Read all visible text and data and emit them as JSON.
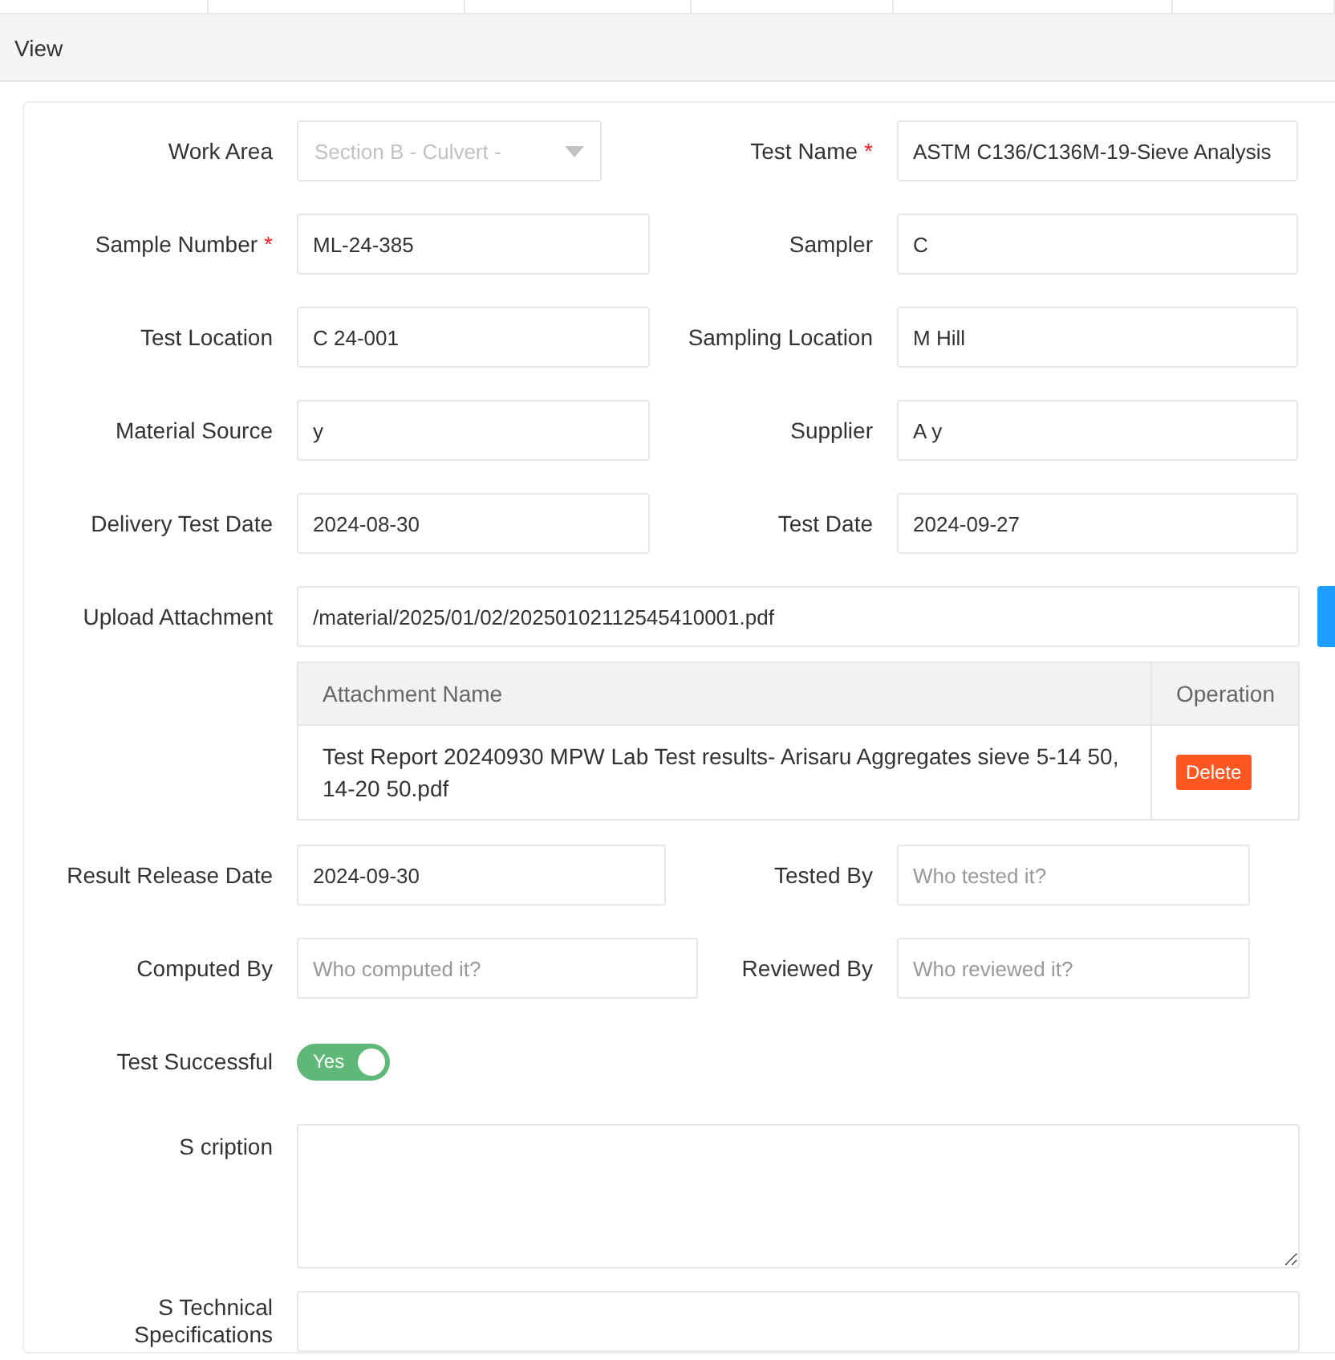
{
  "header": {
    "title": "View"
  },
  "rows": [
    {
      "left": {
        "label": "Work Area",
        "kind": "select",
        "value": "Section B - Culvert -",
        "disabled": true
      },
      "right": {
        "label": "Test Name",
        "required_mark": "*",
        "kind": "input",
        "value": "ASTM C136/C136M-19-Sieve Analysis"
      }
    },
    {
      "left": {
        "label": "Sample Number",
        "required_mark": "*",
        "kind": "input",
        "value": "ML-24-385"
      },
      "right": {
        "label": "Sampler",
        "kind": "input",
        "value": "C"
      }
    },
    {
      "left": {
        "label": "Test Location",
        "kind": "input",
        "value": "C 24-001"
      },
      "right": {
        "label": "Sampling Location",
        "kind": "input",
        "value": "M Hill"
      }
    },
    {
      "left": {
        "label": "Material Source",
        "kind": "input",
        "value": "y"
      },
      "right": {
        "label": "Supplier",
        "kind": "input",
        "value": "A y"
      }
    },
    {
      "left": {
        "label": "Delivery Test Date",
        "kind": "input",
        "value": "2024-08-30"
      },
      "right": {
        "label": "Test Date",
        "kind": "input",
        "value": "2024-09-27"
      }
    }
  ],
  "attachment": {
    "label": "Upload Attachment",
    "value": "/material/2025/01/02/20250102112545410001.pdf",
    "columns": [
      "Attachment Name",
      "Operation"
    ],
    "files": [
      {
        "name": "Test Report 20240930 MPW Lab Test results- Arisaru Aggregates sieve 5-14 50, 14-20 50.pdf",
        "action": "Delete"
      }
    ]
  },
  "rows2": [
    {
      "left": {
        "label": "Result Release Date",
        "kind": "input",
        "value": "2024-09-30"
      },
      "right": {
        "label": "Tested By",
        "kind": "input",
        "placeholder": "Who tested it?"
      }
    },
    {
      "left": {
        "label": "Computed By",
        "kind": "input",
        "placeholder": "Who computed it?"
      },
      "right": {
        "label": "Reviewed By",
        "kind": "input",
        "placeholder": "Who reviewed it?"
      }
    }
  ],
  "toggle": {
    "label": "Test Successful",
    "on": true,
    "text": "Yes"
  },
  "textareas": [
    {
      "label": "S cription"
    },
    {
      "label": "S Technical Specifications"
    }
  ]
}
